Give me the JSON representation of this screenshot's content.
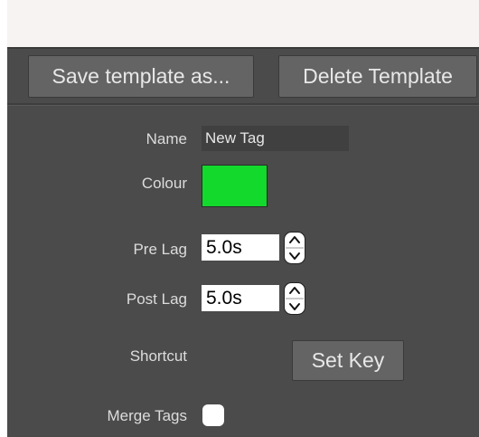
{
  "toolbar": {
    "save_template_label": "Save template as...",
    "delete_template_label": "Delete Template"
  },
  "form": {
    "name_label": "Name",
    "name_value": "New Tag",
    "colour_label": "Colour",
    "colour_value": "#12d92c",
    "pre_lag_label": "Pre Lag",
    "pre_lag_value": "5.0s",
    "post_lag_label": "Post Lag",
    "post_lag_value": "5.0s",
    "shortcut_label": "Shortcut",
    "set_key_label": "Set Key",
    "merge_tags_label": "Merge Tags",
    "merge_tags_checked": false
  },
  "icons": {
    "stepper": "up-down-stepper-icon"
  },
  "colors": {
    "panel_bg": "#4b4b4b",
    "button_bg": "#646464",
    "topbar_bg": "#f6f3f2"
  }
}
